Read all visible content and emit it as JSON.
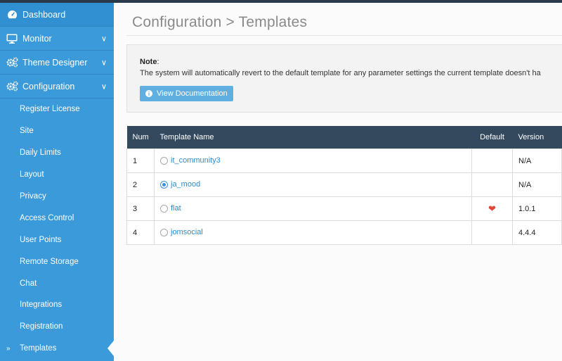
{
  "sidebar": {
    "top_items": [
      {
        "label": "Dashboard",
        "icon": "dashboard-icon",
        "chevron": ""
      },
      {
        "label": "Monitor",
        "icon": "monitor-icon",
        "chevron": "∨"
      },
      {
        "label": "Theme Designer",
        "icon": "gears-icon",
        "chevron": "∨"
      },
      {
        "label": "Configuration",
        "icon": "gears-icon",
        "chevron": "∨"
      }
    ],
    "sub_items": [
      "Register License",
      "Site",
      "Daily Limits",
      "Layout",
      "Privacy",
      "Access Control",
      "User Points",
      "Remote Storage",
      "Chat",
      "Integrations",
      "Registration",
      "Templates"
    ],
    "active_marker": "»"
  },
  "main": {
    "title": "Configuration > Templates",
    "note": {
      "heading": "Note",
      "colon": ":",
      "text": "The system will automatically revert to the default template for any parameter settings the current template doesn't ha",
      "button_label": "View Documentation",
      "button_icon_glyph": "i"
    },
    "table": {
      "headers": {
        "num": "Num",
        "name": "Template Name",
        "default": "Default",
        "version": "Version"
      },
      "rows": [
        {
          "num": "1",
          "name": "it_community3",
          "selected": false,
          "is_default": false,
          "version": "N/A"
        },
        {
          "num": "2",
          "name": "ja_mood",
          "selected": true,
          "is_default": false,
          "version": "N/A"
        },
        {
          "num": "3",
          "name": "flat",
          "selected": false,
          "is_default": true,
          "version": "1.0.1"
        },
        {
          "num": "4",
          "name": "jomsocial",
          "selected": false,
          "is_default": false,
          "version": "4.4.4"
        }
      ]
    }
  },
  "colors": {
    "sidebar_bg": "#3b9ad9",
    "table_header_bg": "#34495e",
    "link": "#2d8cc9",
    "heart": "#e5463b",
    "button_bg": "#5fb0e0"
  }
}
